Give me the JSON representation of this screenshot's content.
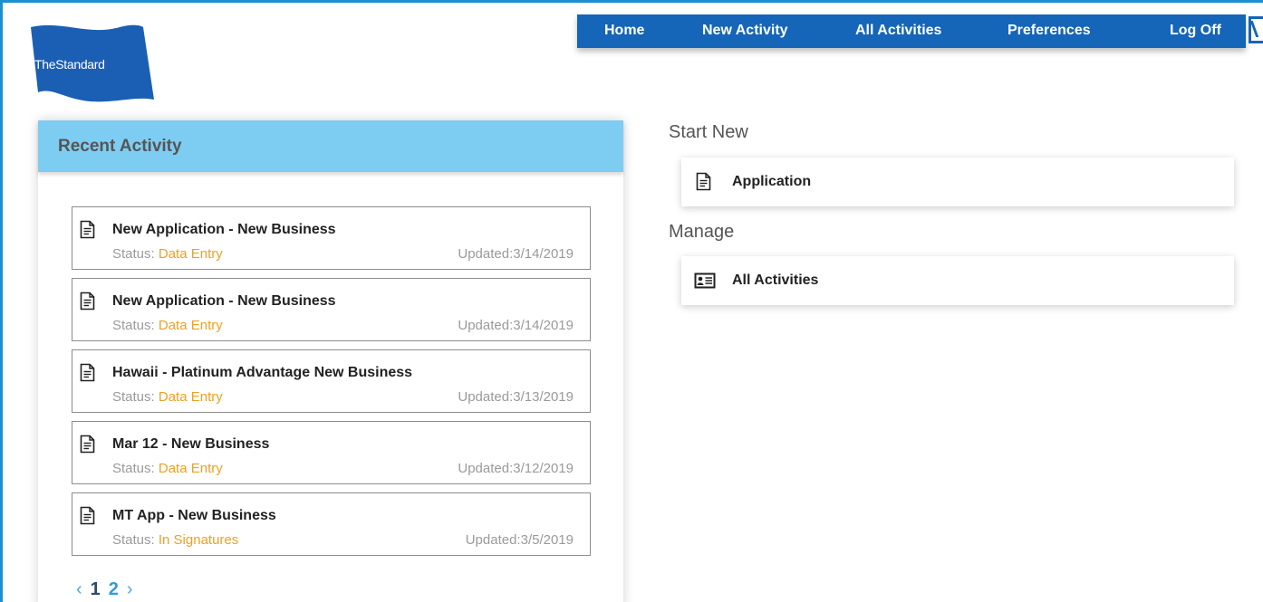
{
  "brand": {
    "logo_text": "TheStandard",
    "color": "#1a5fb4"
  },
  "nav": {
    "items": [
      {
        "label": "Home"
      },
      {
        "label": "New Activity"
      },
      {
        "label": "All Activities"
      },
      {
        "label": "Preferences"
      },
      {
        "label": "Log Off"
      }
    ]
  },
  "recent": {
    "title": "Recent Activity",
    "items": [
      {
        "title": "New Application - New Business",
        "status_label": "Status:",
        "status": "Data Entry",
        "updated": "Updated:3/14/2019"
      },
      {
        "title": "New Application - New Business",
        "status_label": "Status:",
        "status": "Data Entry",
        "updated": "Updated:3/14/2019"
      },
      {
        "title": "Hawaii - Platinum Advantage New Business",
        "status_label": "Status:",
        "status": "Data Entry",
        "updated": "Updated:3/13/2019"
      },
      {
        "title": "Mar 12 - New Business",
        "status_label": "Status:",
        "status": "Data Entry",
        "updated": "Updated:3/12/2019"
      },
      {
        "title": "MT App - New Business",
        "status_label": "Status:",
        "status": "In Signatures",
        "updated": "Updated:3/5/2019"
      }
    ],
    "pager": {
      "prev": "‹",
      "pages": [
        "1",
        "2"
      ],
      "next": "›"
    }
  },
  "start_new": {
    "title": "Start New",
    "items": [
      {
        "label": "Application",
        "icon": "document-icon"
      }
    ]
  },
  "manage": {
    "title": "Manage",
    "items": [
      {
        "label": "All Activities",
        "icon": "id-card-icon"
      }
    ]
  },
  "colors": {
    "nav_bg": "#1565b8",
    "panel_header_bg": "#7dcdf3",
    "status_accent": "#f0a020",
    "pager_link": "#3399dd"
  }
}
